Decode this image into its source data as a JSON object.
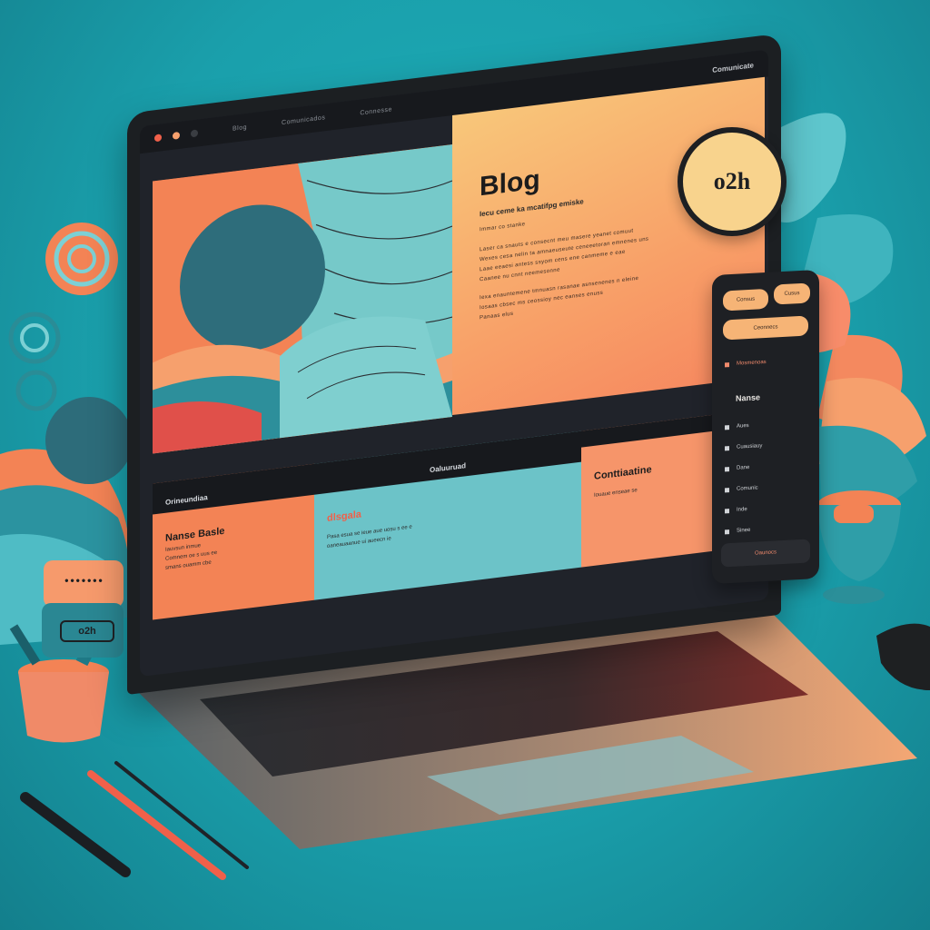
{
  "colors": {
    "background": "#1aa4b0",
    "accent_orange": "#f38355",
    "accent_peach": "#f8c77a",
    "teal_light": "#76c9c9",
    "dark": "#1c1f22"
  },
  "browser": {
    "nav_links": [
      "Blog",
      "Comunicados",
      "Connesse"
    ],
    "brand_text": "Comunicate"
  },
  "badge": {
    "text": "o2h"
  },
  "blog": {
    "title": "Blog",
    "subtitle": "Iecu ceme ka mcatifpg emiske",
    "lines": [
      "Immar co stanke",
      "Laser ca snauts e consecnt meu masere yeanet comuut",
      "Wexes cesa nelin ta amnaeuseute ceneeetoran emnenes uns",
      "Laae eeaesi antess ssyom cens ene canmeme e eae",
      "Caanee nu cnnt neemesonne",
      "Iexa enauntemene tmnuasn rasanae asnsenenes n eleine",
      "Iosaas cbsec ms ceossioy nec eanses enuss",
      "Panaas elus"
    ]
  },
  "cards": [
    {
      "header": "Orineundiaa",
      "title": "Nanse Basle",
      "lines": [
        "Iauvsun inmue",
        "Comnem oe s uus ee",
        "smans ouamm cbe"
      ]
    },
    {
      "header": "Oaluuruad",
      "title": "dlsgala",
      "lines": [
        "Pasa esua se ieue aue uosu s ee e",
        "oaneauaanue ui aueecn ie"
      ]
    },
    {
      "header": "",
      "title": "Conttiaatine",
      "lines": [
        "Iouaue enseae se"
      ]
    }
  ],
  "phone": {
    "pills": [
      "Consus",
      "Cusus",
      "Ceonnecs"
    ],
    "menu_item": "Mosmenoas",
    "heading": "Nanse",
    "items": [
      "Aues",
      "Cuausiauy",
      "Dane",
      "Comunic",
      "Inde",
      "Sinee"
    ],
    "footer": "Oaunocs"
  },
  "sticky_note": {
    "text": "•••••••"
  },
  "desk_label": {
    "text": "o2h"
  }
}
